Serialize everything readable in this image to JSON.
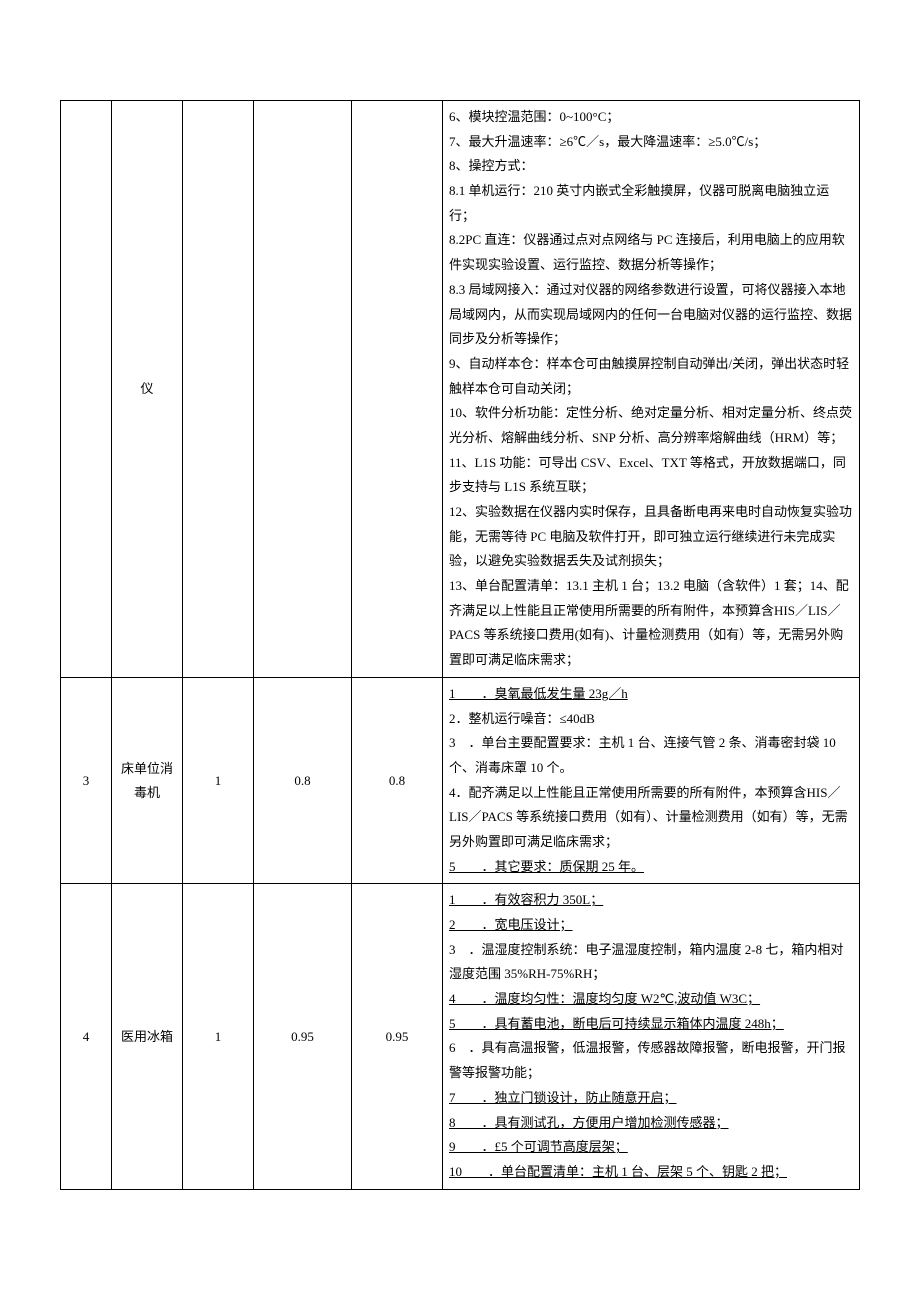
{
  "rows": [
    {
      "id": "",
      "name": "仪",
      "qty": "",
      "price": "",
      "total": "",
      "specs": [
        "6、模块控温范围：0~100°C；",
        "7、最大升温速率：≥6℃／s，最大降温速率：≥5.0℃/s；",
        "8、操控方式：",
        "8.1 单机运行：210 英寸内嵌式全彩触摸屏，仪器可脱离电脑独立运行；",
        "8.2PC 直连：仪器通过点对点网络与 PC 连接后，利用电脑上的应用软件实现实验设置、运行监控、数据分析等操作；",
        "8.3 局域网接入：通过对仪器的网络参数进行设置，可将仪器接入本地局域网内，从而实现局域网内的任何一台电脑对仪器的运行监控、数据同步及分析等操作；",
        "9、自动样本仓：样本仓可由触摸屏控制自动弹出/关闭，弹出状态时轻触样本仓可自动关闭；",
        "10、软件分析功能：定性分析、绝对定量分析、相对定量分析、终点荧光分析、熔解曲线分析、SNP 分析、高分辨率熔解曲线（HRM）等；",
        "11、L1S 功能：可导出 CSV、Excel、TXT 等格式，开放数据端口，同步支持与 L1S 系统互联；",
        "12、实验数据在仪器内实时保存，且具备断电再来电时自动恢复实验功能，无需等待 PC 电脑及软件打开，即可独立运行继续进行未完成实验，以避免实验数据丢失及试剂损失；",
        "13、单台配置清单：13.1 主机 1 台；13.2 电脑（含软件）1 套；14、配齐满足以上性能且正常使用所需要的所有附件，本预算含HIS／LIS／PACS 等系统接口费用(如有)、计量检测费用（如有）等，无需另外购置即可满足临床需求；"
      ]
    },
    {
      "id": "3",
      "name": "床单位消毒机",
      "qty": "1",
      "price": "0.8",
      "total": "0.8",
      "specs": [
        "1　　．臭氧最低发生量 23g／h",
        "2．整机运行噪音：≤40dB",
        "3　．单台主要配置要求：主机 1 台、连接气管 2 条、消毒密封袋 10个、消毒床罩 10 个。",
        "4．配齐满足以上性能且正常使用所需要的所有附件，本预算含HIS／LIS／PACS 等系统接口费用（如有）、计量检测费用（如有）等，无需另外购置即可满足临床需求；",
        "5　　．其它要求：质保期 25 年。"
      ]
    },
    {
      "id": "4",
      "name": "医用冰箱",
      "qty": "1",
      "price": "0.95",
      "total": "0.95",
      "specs": [
        "1　　．有效容积力 350L；",
        "2　　．宽电压设计；",
        "3　．温湿度控制系统：电子温湿度控制，箱内温度 2-8 七，箱内相对湿度范围 35%RH-75%RH；",
        "4　　．温度均匀性：温度均匀度 W2℃,波动值 W3C；",
        "5　　．具有蓄电池，断电后可持续显示箱体内温度 248h；",
        "6　．具有高温报警，低温报警，传感器故障报警，断电报警，开门报警等报警功能；",
        "7　　．独立门锁设计，防止随意开启；",
        "8　　．具有测试孔，方便用户增加检测传感器；",
        "9　　．£5 个可调节高度层架；",
        "10　　．单台配置清单：主机 1 台、层架 5 个、钥匙 2 把；"
      ]
    }
  ]
}
